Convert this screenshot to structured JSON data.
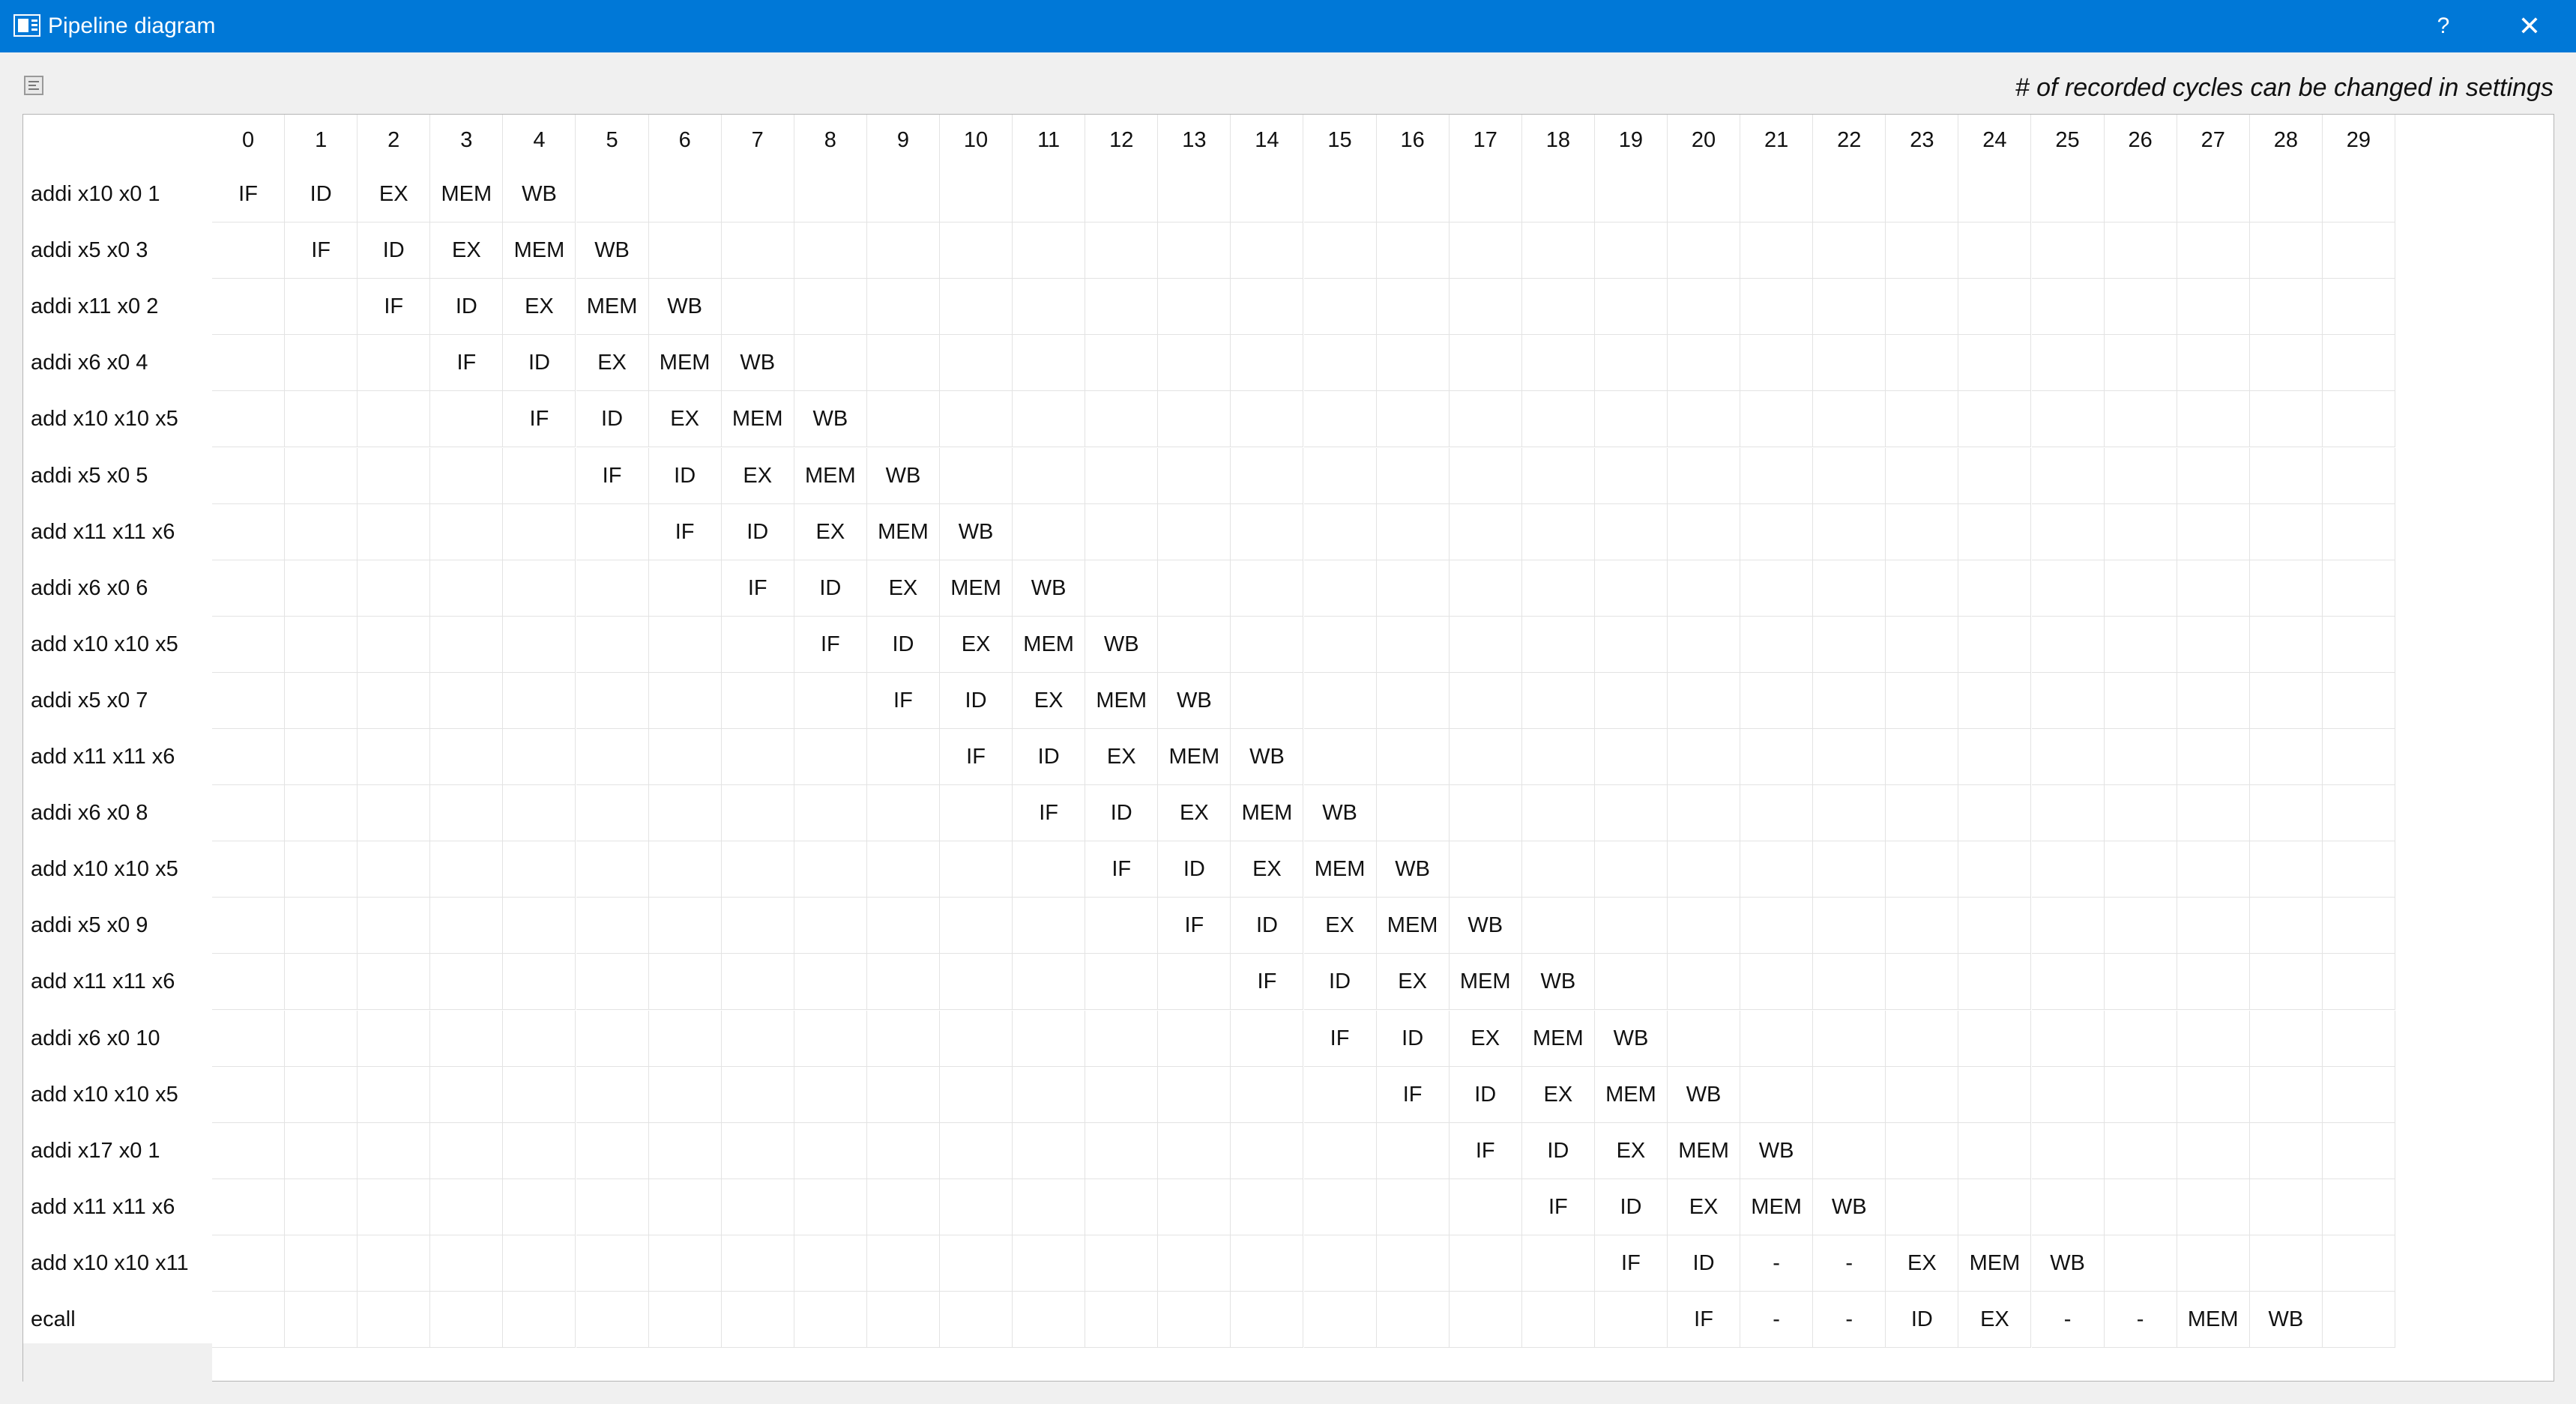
{
  "window": {
    "title": "Pipeline diagram",
    "help_label": "?",
    "close_label": "✕"
  },
  "toolbar": {
    "hint": "# of recorded cycles can be changed in settings"
  },
  "cycles": [
    "0",
    "1",
    "2",
    "3",
    "4",
    "5",
    "6",
    "7",
    "8",
    "9",
    "10",
    "11",
    "12",
    "13",
    "14",
    "15",
    "16",
    "17",
    "18",
    "19",
    "20",
    "21",
    "22",
    "23",
    "24",
    "25",
    "26",
    "27",
    "28",
    "29"
  ],
  "rows": [
    {
      "instr": "addi x10 x0 1",
      "start": 0,
      "stages": [
        "IF",
        "ID",
        "EX",
        "MEM",
        "WB"
      ]
    },
    {
      "instr": "addi x5 x0 3",
      "start": 1,
      "stages": [
        "IF",
        "ID",
        "EX",
        "MEM",
        "WB"
      ]
    },
    {
      "instr": "addi x11 x0 2",
      "start": 2,
      "stages": [
        "IF",
        "ID",
        "EX",
        "MEM",
        "WB"
      ]
    },
    {
      "instr": "addi x6 x0 4",
      "start": 3,
      "stages": [
        "IF",
        "ID",
        "EX",
        "MEM",
        "WB"
      ]
    },
    {
      "instr": "add x10 x10 x5",
      "start": 4,
      "stages": [
        "IF",
        "ID",
        "EX",
        "MEM",
        "WB"
      ]
    },
    {
      "instr": "addi x5 x0 5",
      "start": 5,
      "stages": [
        "IF",
        "ID",
        "EX",
        "MEM",
        "WB"
      ]
    },
    {
      "instr": "add x11 x11 x6",
      "start": 6,
      "stages": [
        "IF",
        "ID",
        "EX",
        "MEM",
        "WB"
      ]
    },
    {
      "instr": "addi x6 x0 6",
      "start": 7,
      "stages": [
        "IF",
        "ID",
        "EX",
        "MEM",
        "WB"
      ]
    },
    {
      "instr": "add x10 x10 x5",
      "start": 8,
      "stages": [
        "IF",
        "ID",
        "EX",
        "MEM",
        "WB"
      ]
    },
    {
      "instr": "addi x5 x0 7",
      "start": 9,
      "stages": [
        "IF",
        "ID",
        "EX",
        "MEM",
        "WB"
      ]
    },
    {
      "instr": "add x11 x11 x6",
      "start": 10,
      "stages": [
        "IF",
        "ID",
        "EX",
        "MEM",
        "WB"
      ]
    },
    {
      "instr": "addi x6 x0 8",
      "start": 11,
      "stages": [
        "IF",
        "ID",
        "EX",
        "MEM",
        "WB"
      ]
    },
    {
      "instr": "add x10 x10 x5",
      "start": 12,
      "stages": [
        "IF",
        "ID",
        "EX",
        "MEM",
        "WB"
      ]
    },
    {
      "instr": "addi x5 x0 9",
      "start": 13,
      "stages": [
        "IF",
        "ID",
        "EX",
        "MEM",
        "WB"
      ]
    },
    {
      "instr": "add x11 x11 x6",
      "start": 14,
      "stages": [
        "IF",
        "ID",
        "EX",
        "MEM",
        "WB"
      ]
    },
    {
      "instr": "addi x6 x0 10",
      "start": 15,
      "stages": [
        "IF",
        "ID",
        "EX",
        "MEM",
        "WB"
      ]
    },
    {
      "instr": "add x10 x10 x5",
      "start": 16,
      "stages": [
        "IF",
        "ID",
        "EX",
        "MEM",
        "WB"
      ]
    },
    {
      "instr": "addi x17 x0 1",
      "start": 17,
      "stages": [
        "IF",
        "ID",
        "EX",
        "MEM",
        "WB"
      ]
    },
    {
      "instr": "add x11 x11 x6",
      "start": 18,
      "stages": [
        "IF",
        "ID",
        "EX",
        "MEM",
        "WB"
      ]
    },
    {
      "instr": "add x10 x10 x11",
      "start": 19,
      "stages": [
        "IF",
        "ID",
        "-",
        "-",
        "EX",
        "MEM",
        "WB"
      ]
    },
    {
      "instr": "ecall",
      "start": 20,
      "stages": [
        "IF",
        "-",
        "-",
        "ID",
        "EX",
        "-",
        "-",
        "MEM",
        "WB"
      ]
    }
  ],
  "colors": {
    "titlebar": "#0078d7",
    "background": "#f0f0f0",
    "gridline": "#e3e3e3"
  }
}
